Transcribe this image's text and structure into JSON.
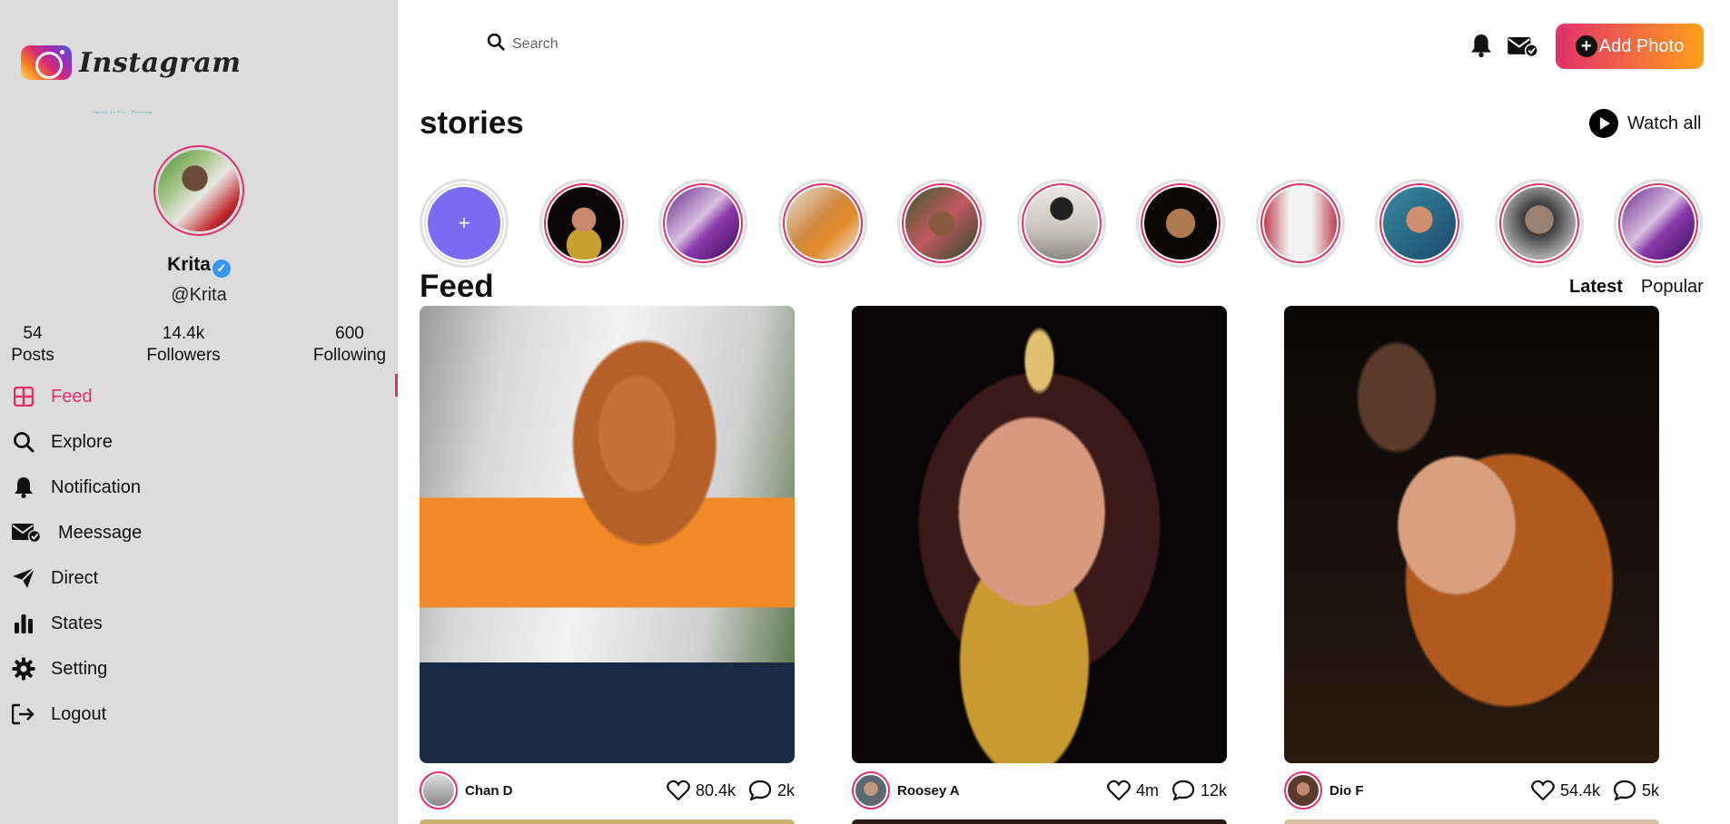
{
  "app": {
    "logo_text": "Instagram",
    "logo_sub": "Switch to Pro · Premium"
  },
  "profile": {
    "name": "Krita",
    "handle": "@Krita"
  },
  "stats": [
    {
      "value": "54",
      "label": "Posts"
    },
    {
      "value": "14.4k",
      "label": "Followers"
    },
    {
      "value": "600",
      "label": "Following"
    }
  ],
  "nav": [
    {
      "label": "Feed",
      "icon": "grid-icon",
      "active": true
    },
    {
      "label": "Explore",
      "icon": "search-icon"
    },
    {
      "label": "Notification",
      "icon": "bell-icon"
    },
    {
      "label": "Meessage",
      "icon": "mail-check-icon"
    },
    {
      "label": "Direct",
      "icon": "send-icon"
    },
    {
      "label": "States",
      "icon": "bar-chart-icon"
    },
    {
      "label": "Setting",
      "icon": "gear-icon"
    },
    {
      "label": "Logout",
      "icon": "logout-icon"
    }
  ],
  "topbar": {
    "search_placeholder": "Search",
    "add_photo": "Add Photo"
  },
  "stories": {
    "title": "stories",
    "watch_all": "Watch all"
  },
  "feed": {
    "title": "Feed",
    "tabs": [
      "Latest",
      "Popular"
    ],
    "posts": [
      {
        "user": "Chan D",
        "likes": "80.4k",
        "comments": "2k"
      },
      {
        "user": "Roosey A",
        "likes": "4m",
        "comments": "12k"
      },
      {
        "user": "Dio F",
        "likes": "54.4k",
        "comments": "5k"
      }
    ]
  },
  "colors": {
    "accent": "#e1306c",
    "sidebar_bg": "#dcdcdc",
    "button_gradient_start": "#e1306c",
    "button_gradient_end": "#ff9f1a"
  }
}
